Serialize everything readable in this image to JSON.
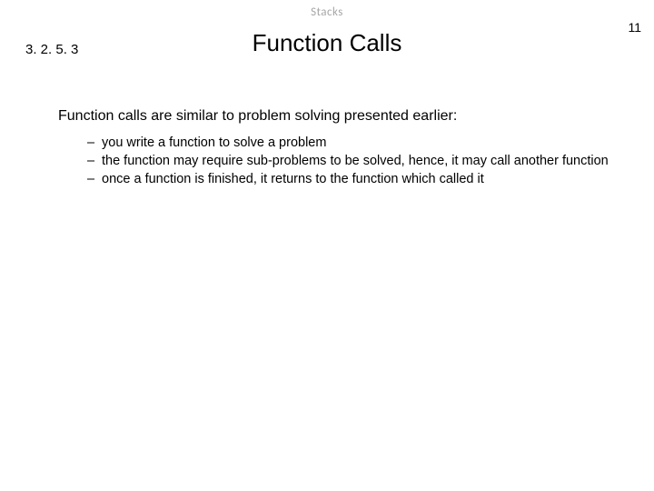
{
  "header": {
    "topic": "Stacks",
    "page_number": "11"
  },
  "section_number": "3. 2. 5. 3",
  "title": "Function Calls",
  "body": {
    "intro": "Function calls are similar to problem solving presented earlier:",
    "bullets": [
      "you write a function to solve a problem",
      "the function may require sub-problems to be solved, hence, it may call another function",
      "once a function is finished, it returns to the function which called it"
    ]
  }
}
